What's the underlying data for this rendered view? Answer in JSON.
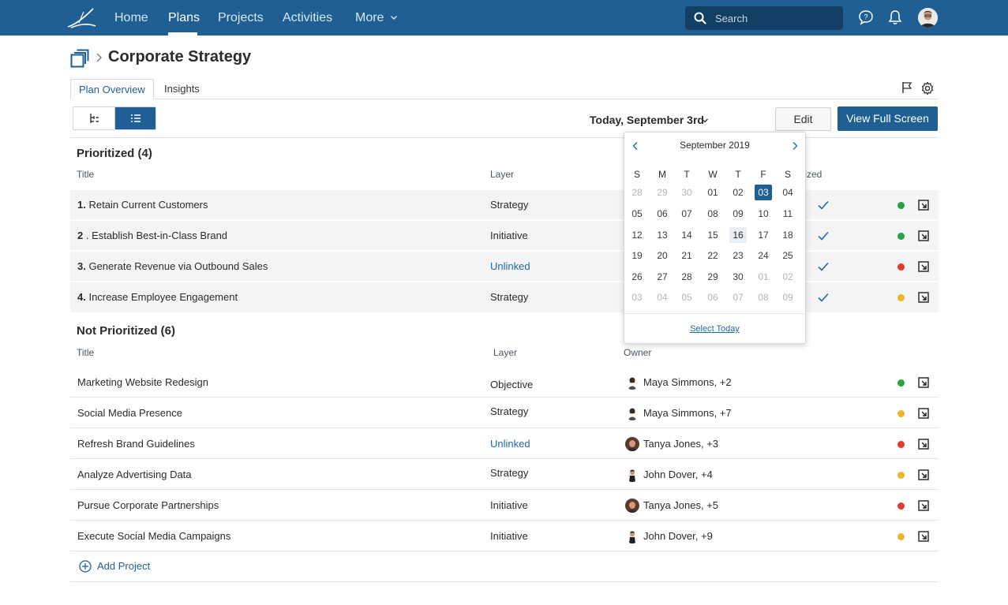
{
  "nav": {
    "items": [
      "Home",
      "Plans",
      "Projects",
      "Activities",
      "More"
    ],
    "active": "Plans",
    "search_placeholder": "Search"
  },
  "page": {
    "title": "Corporate Strategy",
    "tabs": [
      "Plan Overview",
      "Insights"
    ]
  },
  "toolbar": {
    "date_label": "Today, September 3rd",
    "edit_label": "Edit",
    "full_screen_label": "View Full Screen"
  },
  "prioritized": {
    "title": "Prioritized (4)",
    "columns": {
      "title": "Title",
      "layer": "Layer",
      "prioritized": "Prioritized"
    },
    "rows": [
      {
        "num": "1.",
        "title": "Retain Current Customers",
        "layer": "Strategy",
        "layer_link": false,
        "status": "#27a244"
      },
      {
        "num": "2",
        "title": ". Establish Best-in-Class Brand",
        "layer": "Initiative",
        "layer_link": false,
        "status": "#27a244"
      },
      {
        "num": "3.",
        "title": "Generate Revenue via Outbound Sales",
        "layer": "Unlinked",
        "layer_link": true,
        "status": "#e63a2e"
      },
      {
        "num": "4.",
        "title": "Increase Employee Engagement",
        "layer": "Strategy",
        "layer_link": false,
        "status": "#ecb52c"
      }
    ]
  },
  "not_prioritized": {
    "title": "Not Prioritized (6)",
    "columns": {
      "title": "Title",
      "layer": "Layer",
      "owner": "Owner"
    },
    "rows": [
      {
        "title": "Marketing Website Redesign",
        "layer": "Objective",
        "layer_link": false,
        "owner": "Maya Simmons, +2",
        "avatar": "maya",
        "status": "#27a244"
      },
      {
        "title": "Social Media Presence",
        "layer": "Strategy",
        "layer_link": false,
        "owner": "Maya Simmons, +7",
        "avatar": "maya",
        "status": "#ecb52c"
      },
      {
        "title": "Refresh Brand Guidelines",
        "layer": "Unlinked",
        "layer_link": true,
        "owner": "Tanya Jones, +3",
        "avatar": "tanya",
        "status": "#e63a2e"
      },
      {
        "title": "Analyze Advertising Data",
        "layer": "Strategy",
        "layer_link": false,
        "owner": "John Dover, +4",
        "avatar": "john",
        "status": "#ecb52c"
      },
      {
        "title": "Pursue Corporate Partnerships",
        "layer": "Initiative",
        "layer_link": false,
        "owner": "Tanya Jones, +5",
        "avatar": "tanya",
        "status": "#e63a2e"
      },
      {
        "title": "Execute Social Media Campaigns",
        "layer": "Initiative",
        "layer_link": false,
        "owner": "John Dover, +9",
        "avatar": "john",
        "status": "#ecb52c"
      }
    ],
    "add_label": "Add Project"
  },
  "calendar": {
    "month_label": "September 2019",
    "weekdays": [
      "S",
      "M",
      "T",
      "W",
      "T",
      "F",
      "S"
    ],
    "weeks": [
      [
        {
          "d": "28",
          "m": true
        },
        {
          "d": "29",
          "m": true
        },
        {
          "d": "30",
          "m": true
        },
        {
          "d": "01"
        },
        {
          "d": "02"
        },
        {
          "d": "03",
          "sel": true
        },
        {
          "d": "04"
        }
      ],
      [
        {
          "d": "05"
        },
        {
          "d": "06"
        },
        {
          "d": "07"
        },
        {
          "d": "08"
        },
        {
          "d": "09"
        },
        {
          "d": "10"
        },
        {
          "d": "11"
        }
      ],
      [
        {
          "d": "12"
        },
        {
          "d": "13"
        },
        {
          "d": "14"
        },
        {
          "d": "15"
        },
        {
          "d": "16",
          "today": true
        },
        {
          "d": "17"
        },
        {
          "d": "18"
        }
      ],
      [
        {
          "d": "19"
        },
        {
          "d": "20"
        },
        {
          "d": "21"
        },
        {
          "d": "22"
        },
        {
          "d": "23"
        },
        {
          "d": "24"
        },
        {
          "d": "25"
        }
      ],
      [
        {
          "d": "26"
        },
        {
          "d": "27"
        },
        {
          "d": "28"
        },
        {
          "d": "29"
        },
        {
          "d": "30"
        },
        {
          "d": "01",
          "m": true
        },
        {
          "d": "02",
          "m": true
        }
      ],
      [
        {
          "d": "03",
          "m": true
        },
        {
          "d": "04",
          "m": true
        },
        {
          "d": "05",
          "m": true
        },
        {
          "d": "06",
          "m": true
        },
        {
          "d": "07",
          "m": true
        },
        {
          "d": "08",
          "m": true
        },
        {
          "d": "09",
          "m": true
        }
      ]
    ],
    "select_today_label": "Select Today"
  },
  "colors": {
    "brand": "#1f5f94",
    "link": "#1f6aa8",
    "green": "#27a244",
    "red": "#e63a2e",
    "yellow": "#ecb52c"
  }
}
